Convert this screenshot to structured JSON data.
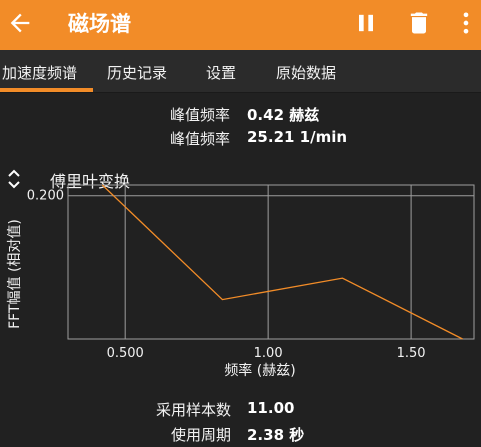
{
  "appbar": {
    "title": "磁场谱"
  },
  "tabs": [
    "加速度频谱",
    "历史记录",
    "设置",
    "原始数据"
  ],
  "peak": {
    "label1": "峰值频率",
    "value1": "0.42 赫兹",
    "label2": "峰值频率",
    "value2": "25.21 1/min"
  },
  "chart": {
    "title": "傅里叶变换"
  },
  "chart_data": {
    "type": "line",
    "title": "傅里叶变换",
    "xlabel": "频率 (赫兹)",
    "ylabel": "FFT幅值 (相对值)",
    "xlim": [
      0.3,
      1.72
    ],
    "ylim": [
      0.0,
      0.215
    ],
    "x_ticks": [
      "0.500",
      "1.00",
      "1.50"
    ],
    "y_ticks": [
      "0.200"
    ],
    "grid": true,
    "color": "#f28c28",
    "series": [
      {
        "x": [
          0.42,
          0.84,
          1.26,
          1.68
        ],
        "values": [
          0.215,
          0.055,
          0.085,
          0.0
        ]
      }
    ]
  },
  "footer": {
    "label1": "采用样本数",
    "value1": "11.00",
    "label2": "使用周期",
    "value2": "2.38 秒"
  },
  "icons": [
    "back-arrow-icon",
    "pause-icon",
    "trash-icon",
    "more-vert-icon",
    "expand-icon"
  ]
}
